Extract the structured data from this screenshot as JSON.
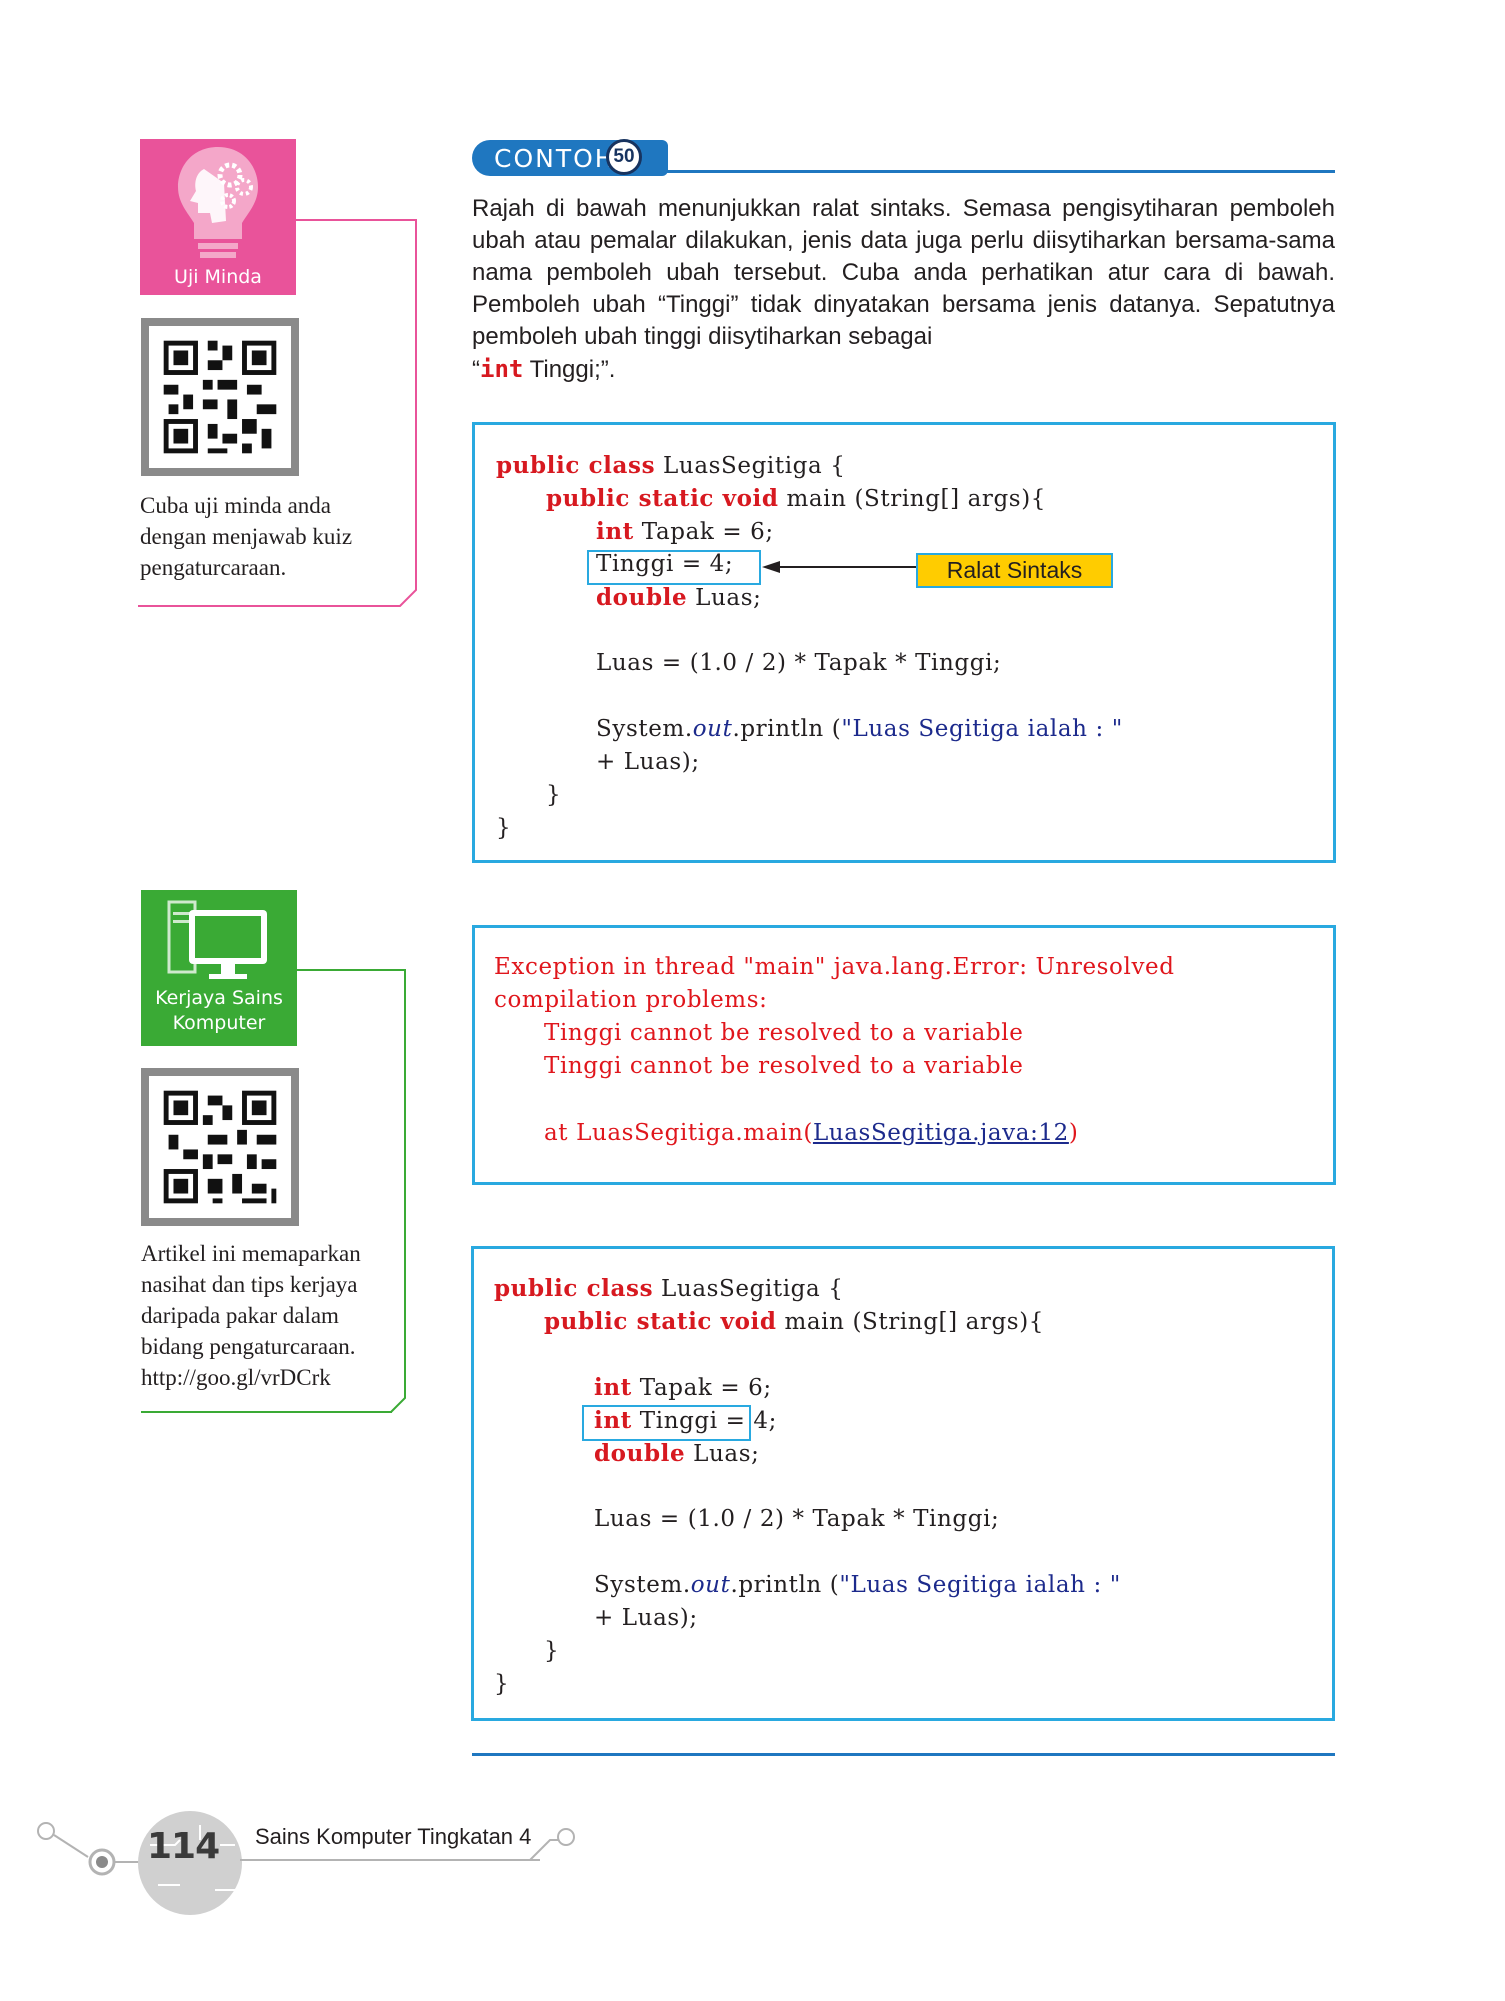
{
  "sidebar": {
    "uji_minda": {
      "label": "Uji Minda",
      "text": [
        "Cuba uji minda anda",
        "dengan menjawab kuiz",
        "pengaturcaraan."
      ],
      "color": "#e9539a"
    },
    "kerjaya": {
      "label_lines": [
        "Kerjaya Sains",
        "Komputer"
      ],
      "text": [
        "Artikel ini memaparkan",
        "nasihat dan tips kerjaya",
        "daripada pakar dalam",
        "bidang pengaturcaraan.",
        "http://goo.gl/vrDCrk"
      ],
      "color": "#3aaa35"
    }
  },
  "example": {
    "label": "CONTOH",
    "number": "50",
    "intro_lines": [
      "Rajah di bawah menunjukkan ralat sintaks. Semasa pengisytiharan pemboleh ubah atau pemalar dilakukan, jenis data juga perlu diisytiharkan bersama-sama nama pemboleh ubah tersebut. Cuba anda perhatikan atur cara di bawah. Pemboleh ubah “Tinggi” tidak dinyatakan bersama jenis datanya. Sepatutnya pemboleh ubah tinggi diisytiharkan sebagai"
    ],
    "intro_end_open": "“",
    "intro_end_kw": "int",
    "intro_end_close": " Tinggi;”."
  },
  "code1": {
    "l1_k": "public class",
    "l1_t": " LuasSegitiga {",
    "l2_k": "public static void",
    "l2_t": " main (String[] args){",
    "l3_k": "int",
    "l3_t": " Tapak = 6;",
    "l4_t": "Tinggi = 4;",
    "l5_k": "double",
    "l5_t": " Luas;",
    "l6_t": "Luas = (1.0 / 2) * Tapak * Tinggi;",
    "l7_a": "System.",
    "l7_b": "out",
    "l7_c": ".println (",
    "l7_d": "\"Luas Segitiga ialah : \"",
    "l8_t": "+ Luas);",
    "l9_t": "}",
    "l10_t": "}",
    "annotation": "Ralat Sintaks"
  },
  "error_output": {
    "l1": "Exception in thread \"main\" java.lang.Error: Unresolved",
    "l2": "compilation problems:",
    "l3": "Tinggi cannot be resolved to a variable",
    "l4": "Tinggi cannot be resolved to a variable",
    "l5_a": "at LuasSegitiga.main(",
    "l5_link": "LuasSegitiga.java:12",
    "l5_b": ")"
  },
  "code2": {
    "l1_k": "public class",
    "l1_t": " LuasSegitiga {",
    "l2_k": "public static void",
    "l2_t": " main (String[] args){",
    "l3_k": "int",
    "l3_t": " Tapak = 6;",
    "l4_k": "int",
    "l4_t": " Tinggi",
    "l4_t2": " = 4;",
    "l5_k": "double",
    "l5_t": " Luas;",
    "l6_t": "Luas = (1.0 / 2) * Tapak * Tinggi;",
    "l7_a": "System.",
    "l7_b": "out",
    "l7_c": ".println (",
    "l7_d": "\"Luas Segitiga ialah : \"",
    "l8_t": "+ Luas);",
    "l9_t": "}",
    "l10_t": "}"
  },
  "footer": {
    "page_number": "114",
    "book_title": "Sains Komputer Tingkatan 4"
  }
}
